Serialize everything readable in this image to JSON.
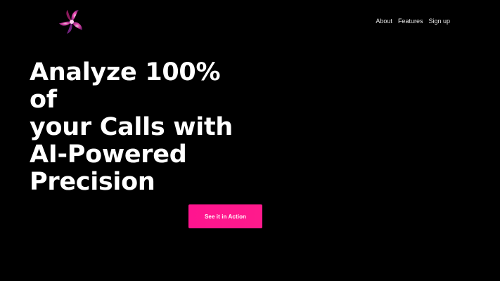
{
  "brand": {
    "logo_icon": "tri-petal-swirl-logo",
    "logo_colors": [
      "#ff2fa8",
      "#c23bd6",
      "#7a1f7a"
    ]
  },
  "nav": {
    "items": [
      {
        "label": "About"
      },
      {
        "label": "Features"
      },
      {
        "label": "Sign up"
      }
    ]
  },
  "hero": {
    "headline_lines": [
      "Analyze 100%",
      "of",
      "your Calls with",
      "AI-Powered",
      "Precision"
    ],
    "cta_label": "See it in Action"
  },
  "colors": {
    "background": "#000000",
    "text": "#ffffff",
    "accent": "#ff1493"
  }
}
